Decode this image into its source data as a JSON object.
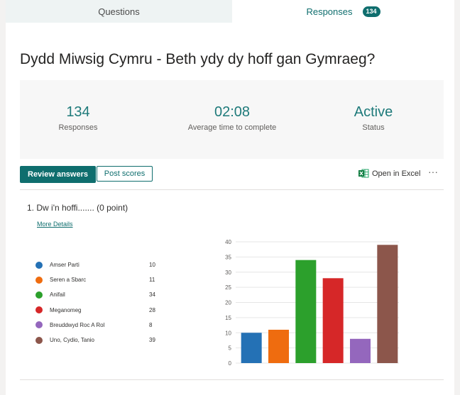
{
  "tabs": {
    "questions": "Questions",
    "responses": "Responses",
    "responses_badge": "134"
  },
  "form": {
    "title": "Dydd Miwsig Cymru - Beth ydy dy hoff gan Gymraeg?"
  },
  "summary": {
    "responses_value": "134",
    "responses_label": "Responses",
    "avg_time_value": "02:08",
    "avg_time_label": "Average time to complete",
    "status_value": "Active",
    "status_label": "Status"
  },
  "actions": {
    "review_answers": "Review answers",
    "post_scores": "Post scores",
    "open_in_excel": "Open in Excel",
    "more": "···"
  },
  "question": {
    "number": "1.",
    "text": "Dw i'n hoffi....... (0 point)",
    "more_details": "More Details"
  },
  "chart_data": {
    "type": "bar",
    "categories": [
      "Amser Parti",
      "Seren a Sbarc",
      "Anifail",
      "Meganomeg",
      "Breuddwyd Roc A Rol",
      "Uno, Cydio, Tanio"
    ],
    "values": [
      10,
      11,
      34,
      28,
      8,
      39
    ],
    "colors": [
      "#2471b5",
      "#ef6c0f",
      "#2ca02c",
      "#d62728",
      "#9467bd",
      "#8c564b"
    ],
    "ylim": [
      0,
      40
    ],
    "yticks": [
      0,
      5,
      10,
      15,
      20,
      25,
      30,
      35,
      40
    ],
    "grid": true,
    "legend": "left"
  }
}
